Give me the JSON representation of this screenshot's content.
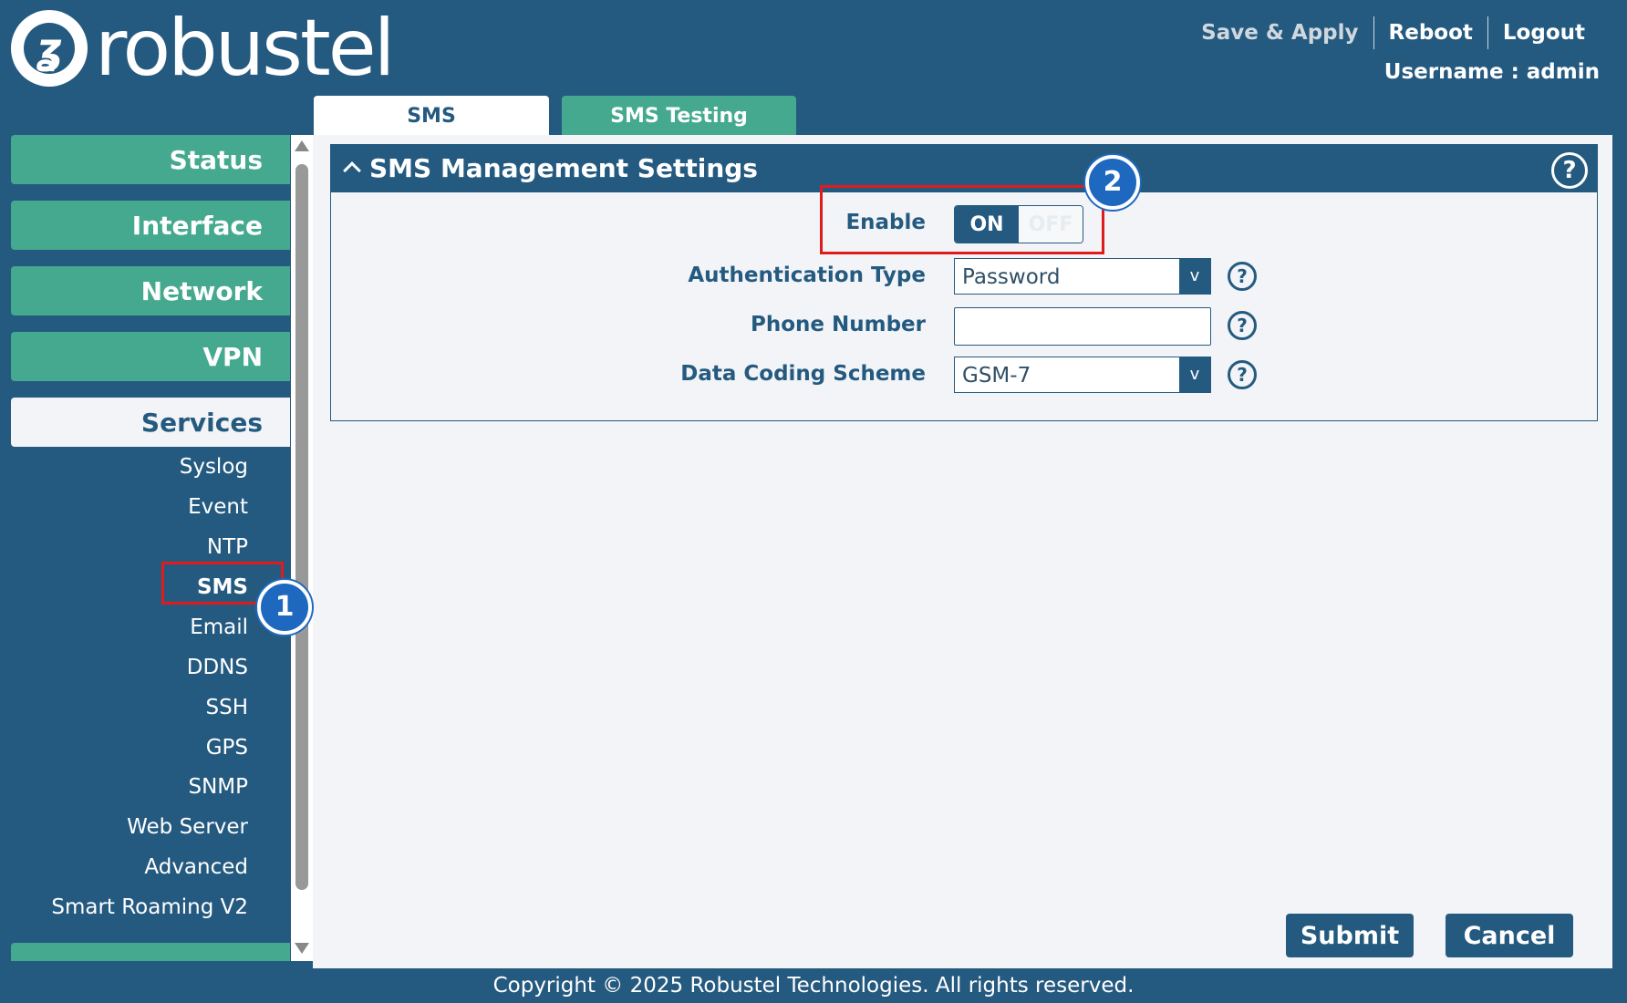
{
  "header": {
    "logo_text": "robustel",
    "links": {
      "save_apply": "Save & Apply",
      "reboot": "Reboot",
      "logout": "Logout"
    },
    "username": "Username : admin"
  },
  "tabs": [
    {
      "label": "SMS",
      "active": true
    },
    {
      "label": "SMS Testing",
      "active": false
    }
  ],
  "sidebar": {
    "main": {
      "status": "Status",
      "interface": "Interface",
      "network": "Network",
      "vpn": "VPN",
      "services": "Services"
    },
    "services_items": [
      "Syslog",
      "Event",
      "NTP",
      "SMS",
      "Email",
      "DDNS",
      "SSH",
      "GPS",
      "SNMP",
      "Web Server",
      "Advanced",
      "Smart Roaming V2"
    ],
    "selected": "SMS"
  },
  "panel": {
    "title": "SMS Management Settings",
    "enable": {
      "label": "Enable",
      "on": "ON",
      "off": "OFF",
      "value": "ON"
    },
    "auth_type": {
      "label": "Authentication Type",
      "value": "Password"
    },
    "phone": {
      "label": "Phone Number",
      "value": ""
    },
    "coding": {
      "label": "Data Coding Scheme",
      "value": "GSM-7"
    }
  },
  "buttons": {
    "submit": "Submit",
    "cancel": "Cancel"
  },
  "footer": "Copyright © 2025 Robustel Technologies. All rights reserved.",
  "annotations": {
    "step1": "1",
    "step2": "2"
  },
  "colors": {
    "primary": "#255a80",
    "accent": "#45a98f",
    "highlight": "#e01b1b",
    "badge": "#1f68bf"
  }
}
